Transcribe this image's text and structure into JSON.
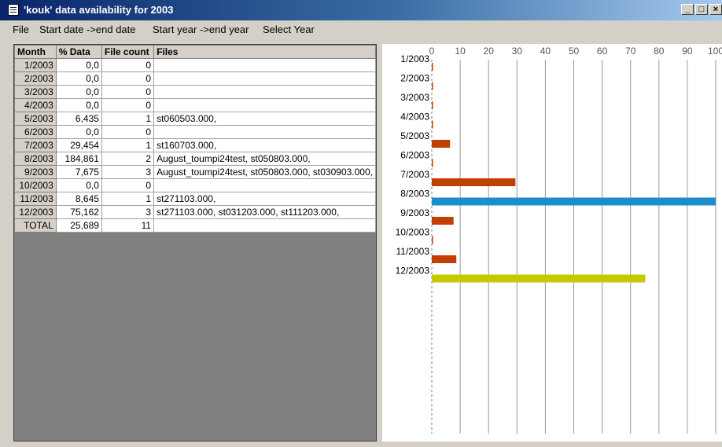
{
  "window": {
    "title": "'kouk' data availability for 2003"
  },
  "menu": [
    "File",
    "Start date ->end date",
    "Start year ->end year",
    "Select Year"
  ],
  "table": {
    "headers": [
      "Month",
      "% Data",
      "File count",
      "Files"
    ],
    "rows": [
      [
        "1/2003",
        "0,0",
        "0",
        ""
      ],
      [
        "2/2003",
        "0,0",
        "0",
        ""
      ],
      [
        "3/2003",
        "0,0",
        "0",
        ""
      ],
      [
        "4/2003",
        "0,0",
        "0",
        ""
      ],
      [
        "5/2003",
        "6,435",
        "1",
        "st060503.000,"
      ],
      [
        "6/2003",
        "0,0",
        "0",
        ""
      ],
      [
        "7/2003",
        "29,454",
        "1",
        "st160703.000,"
      ],
      [
        "8/2003",
        "184,861",
        "2",
        "August_toumpi24test, st050803.000,"
      ],
      [
        "9/2003",
        "7,675",
        "3",
        "August_toumpi24test, st050803.000, st030903.000,"
      ],
      [
        "10/2003",
        "0,0",
        "0",
        ""
      ],
      [
        "11/2003",
        "8,645",
        "1",
        "st271103.000,"
      ],
      [
        "12/2003",
        "75,162",
        "3",
        "st271103.000, st031203.000, st111203.000,"
      ],
      [
        "TOTAL",
        "25,689",
        "11",
        ""
      ]
    ]
  },
  "chart_data": {
    "type": "bar",
    "orientation": "horizontal",
    "categories": [
      "1/2003",
      "2/2003",
      "3/2003",
      "4/2003",
      "5/2003",
      "6/2003",
      "7/2003",
      "8/2003",
      "9/2003",
      "10/2003",
      "11/2003",
      "12/2003"
    ],
    "values": [
      0,
      0,
      0,
      0,
      6.435,
      0,
      29.454,
      184.861,
      7.675,
      0,
      8.645,
      75.162
    ],
    "xlim": [
      0,
      100
    ],
    "xticks": [
      "0",
      "10",
      "20",
      "30",
      "40",
      "50",
      "60",
      "70",
      "80",
      "90",
      "100"
    ],
    "grid": true,
    "bar_colors": [
      "#c04000",
      "#c04000",
      "#c04000",
      "#c04000",
      "#c04000",
      "#c04000",
      "#c04000",
      "#1a8fc8",
      "#c04000",
      "#c04000",
      "#c04000",
      "#c8c800"
    ]
  }
}
